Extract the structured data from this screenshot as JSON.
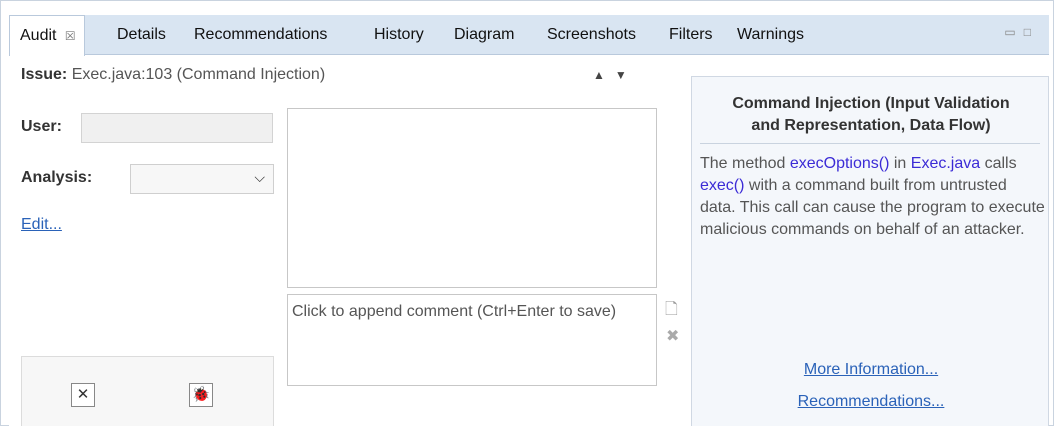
{
  "tabs": [
    {
      "label": "Audit",
      "close": "☒",
      "active": true
    },
    {
      "label": "Details"
    },
    {
      "label": "Recommendations"
    },
    {
      "label": "History"
    },
    {
      "label": "Diagram"
    },
    {
      "label": "Screenshots"
    },
    {
      "label": "Filters"
    },
    {
      "label": "Warnings"
    }
  ],
  "window_controls": {
    "minimize": "▭",
    "maximize": "□"
  },
  "issue": {
    "label": "Issue:",
    "value": "Exec.java:103 (Command Injection)"
  },
  "nav": {
    "up": "▲",
    "down": "▼"
  },
  "form": {
    "user_label": "User:",
    "user_value": "",
    "analysis_label": "Analysis:",
    "analysis_value": "",
    "edit_link": "Edit..."
  },
  "comment": {
    "placeholder": "Click to append comment (Ctrl+Enter to save)"
  },
  "bottom_buttons": {
    "clear": "✕",
    "bug": "🐞"
  },
  "details": {
    "title_line1": "Command Injection (Input Validation",
    "title_line2": "and Representation, Data Flow)",
    "desc_part1": "The method ",
    "desc_method": "execOptions()",
    "desc_part2": " in ",
    "desc_file": "Exec.java",
    "desc_part3": " calls ",
    "desc_call": "exec()",
    "desc_part4": " with a command built from untrusted data. This call can cause the program to execute malicious commands on behalf of an attacker.",
    "more_info": "More Information...",
    "recommendations": "Recommendations..."
  },
  "colors": {
    "tabbar": "#d9e5f2",
    "link": "#2a62b8",
    "highlight": "#3b2bd6"
  }
}
